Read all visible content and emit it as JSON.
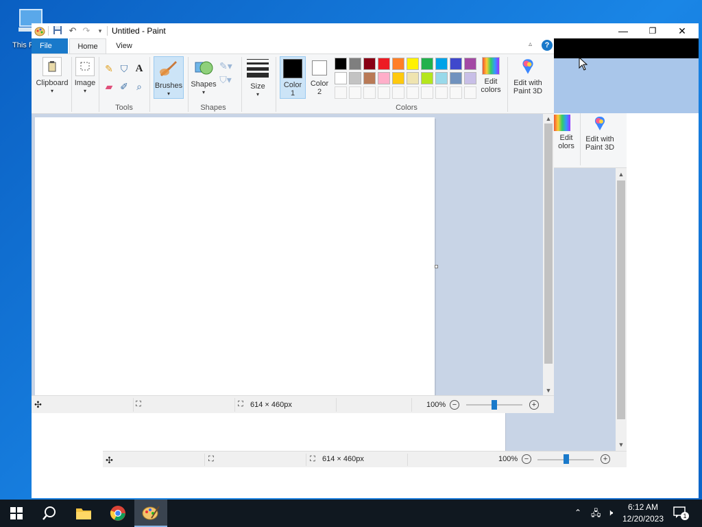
{
  "desktop": {
    "icon_label": "This PC"
  },
  "window": {
    "title": "Untitled - Paint",
    "controls": {
      "minimize": "—",
      "maximize": "❐",
      "close": "✕"
    },
    "tabs": [
      {
        "label": "File"
      },
      {
        "label": "Home"
      },
      {
        "label": "View"
      }
    ]
  },
  "ribbon": {
    "clipboard": {
      "label": "Clipboard"
    },
    "image": {
      "label": "Image"
    },
    "tools": {
      "group_label": "Tools"
    },
    "brushes": {
      "label": "Brushes"
    },
    "shapes": {
      "label": "Shapes",
      "group_label": "Shapes"
    },
    "size": {
      "label": "Size"
    },
    "color1": {
      "label_line1": "Color",
      "label_line2": "1",
      "value": "#000000"
    },
    "color2": {
      "label_line1": "Color",
      "label_line2": "2",
      "value": "#ffffff"
    },
    "colors_group_label": "Colors",
    "edit_colors": {
      "line1": "Edit",
      "line2": "colors"
    },
    "edit_paint3d": {
      "line1": "Edit with",
      "line2": "Paint 3D"
    },
    "palette_row1": [
      "#000000",
      "#7f7f7f",
      "#880015",
      "#ed1c24",
      "#ff7f27",
      "#fff200",
      "#22b14c",
      "#00a2e8",
      "#3f48cc",
      "#a349a4"
    ],
    "palette_row2": [
      "#ffffff",
      "#c3c3c3",
      "#b97a57",
      "#ffaec9",
      "#ffc90e",
      "#efe4b0",
      "#b5e61d",
      "#99d9ea",
      "#7092be",
      "#c8bfe7"
    ]
  },
  "background_window": {
    "edit_colors": {
      "line1": "Edit",
      "line2": "olors"
    },
    "edit_paint3d": {
      "line1": "Edit with",
      "line2": "Paint 3D"
    },
    "status": {
      "dimensions": "614 × 460px",
      "zoom": "100%"
    }
  },
  "status": {
    "dimensions": "614 × 460px",
    "zoom": "100%",
    "zoom_out": "−",
    "zoom_in": "+",
    "zoom_fraction": 0.5
  },
  "taskbar": {
    "time": "6:12 AM",
    "date": "12/20/2023",
    "notification_count": "1"
  }
}
